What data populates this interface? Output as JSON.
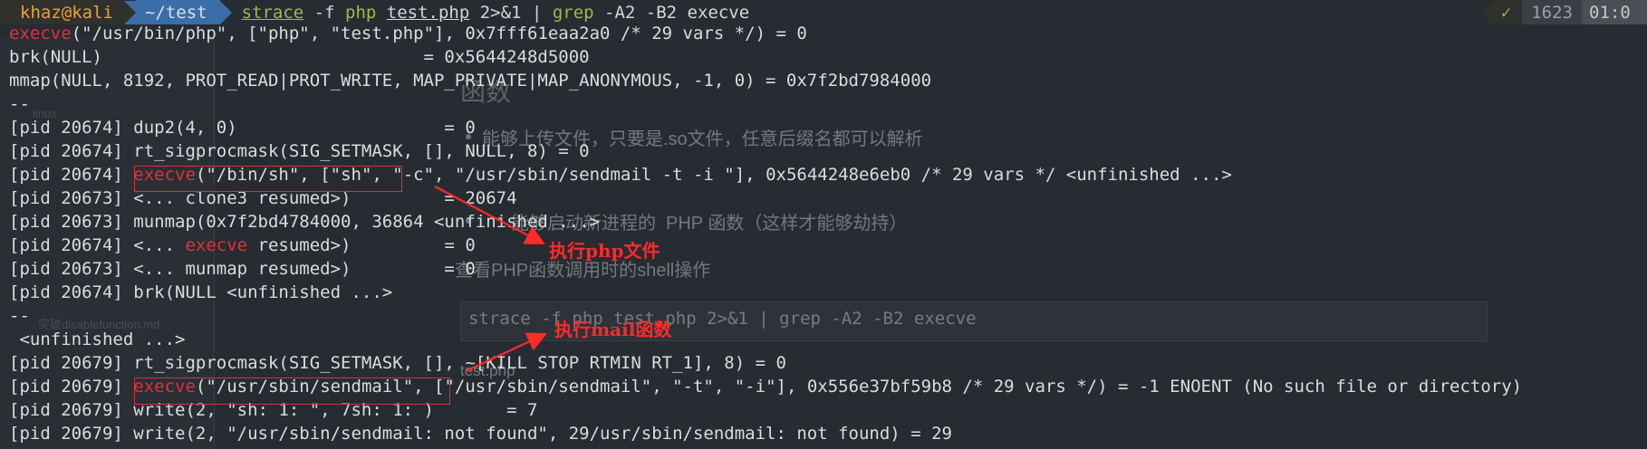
{
  "prompt": {
    "user": "khaz@kali",
    "dir": "~/test",
    "cmd": {
      "strace": "strace",
      "flag": " -f ",
      "php": "php",
      "sp1": " ",
      "file": "test.php",
      "redir": " 2>&1 | ",
      "grep": "grep",
      "args": " -A2 -B2 execve"
    }
  },
  "status": {
    "check": "✓",
    "count": "1623",
    "time": "01:0"
  },
  "lines": [
    {
      "a": "execve",
      "b": "(\"/usr/bin/php\", [\"php\", \"test.php\"], 0x7fff61eaa2a0 /* 29 vars */) = 0"
    },
    {
      "a": "",
      "b": "brk(NULL)                               = 0x5644248d5000"
    },
    {
      "a": "",
      "b": "mmap(NULL, 8192, PROT_READ|PROT_WRITE, MAP_PRIVATE|MAP_ANONYMOUS, -1, 0) = 0x7f2bd7984000"
    },
    {
      "a": "",
      "b": "--"
    },
    {
      "a": "",
      "b": "[pid 20674] dup2(4, 0)                    = 0"
    },
    {
      "a": "",
      "b": "[pid 20674] rt_sigprocmask(SIG_SETMASK, [], NULL, 8) = 0"
    },
    {
      "pre": "[pid 20674] ",
      "a": "execve",
      "b": "(\"/bin/sh\", [\"sh\", \"-c\", \"/usr/sbin/sendmail -t -i \"], 0x5644248e6eb0 /* 29 vars */ <unfinished ...>"
    },
    {
      "a": "",
      "b": "[pid 20673] <... clone3 resumed>)         = 20674"
    },
    {
      "a": "",
      "b": "[pid 20673] munmap(0x7f2bd4784000, 36864 <unfinished ...>"
    },
    {
      "pre": "[pid 20674] <... ",
      "a": "execve",
      "b": " resumed>)         = 0"
    },
    {
      "a": "",
      "b": "[pid 20673] <... munmap resumed>)         = 0"
    },
    {
      "a": "",
      "b": "[pid 20674] brk(NULL <unfinished ...>"
    },
    {
      "a": "",
      "b": "--"
    },
    {
      "a": "",
      "b": " <unfinished ...>"
    },
    {
      "a": "",
      "b": "[pid 20679] rt_sigprocmask(SIG_SETMASK, [], ~[KILL STOP RTMIN RT_1], 8) = 0"
    },
    {
      "pre": "[pid 20679] ",
      "a": "execve",
      "b": "(\"/usr/sbin/sendmail\", [\"/usr/sbin/sendmail\", \"-t\", \"-i\"], 0x556e37bf59b8 /* 29 vars */) = -1 ENOENT (No such file or directory)"
    },
    {
      "a": "",
      "b": "[pid 20679] write(2, \"sh: 1: \", 7sh: 1: )       = 7"
    },
    {
      "a": "",
      "b": "[pid 20679] write(2, \"/usr/sbin/sendmail: not found\", 29/usr/sbin/sendmail: not found) = 29"
    }
  ],
  "annotations": {
    "note1": "执行php文件",
    "note2": "执行mail函数",
    "arrow_color": "#ff2a2a"
  },
  "background_doc": {
    "heading": "函数",
    "bullet1": "能够上传文件，只要是.so文件，任意后缀名都可以解析",
    "bullet2": "PHP 函数（这样才能够劫持）",
    "bullet2_prefix": "能够启动新进程的",
    "para": "查看PHP函数调用时的shell操作",
    "code": "strace -f php test.php 2>&1 | grep -A2 -B2 execve",
    "sub": "test.php",
    "sidebar_item1": "linux",
    "sidebar_item2": "突破disablefunction.md"
  }
}
